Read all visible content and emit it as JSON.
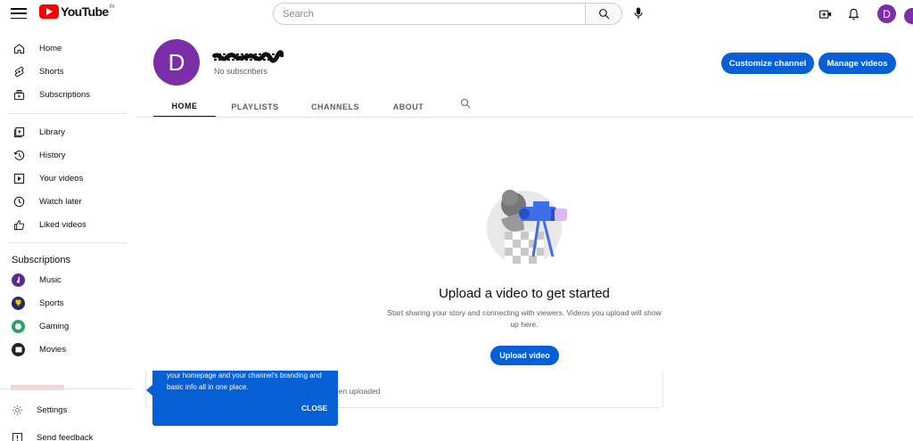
{
  "header": {
    "logo_text": "YouTube",
    "logo_country": "IN",
    "search_placeholder": "Search",
    "avatar_letter": "D"
  },
  "sidebar": {
    "items": [
      {
        "label": "Home",
        "icon": "home-icon"
      },
      {
        "label": "Shorts",
        "icon": "shorts-icon"
      },
      {
        "label": "Subscriptions",
        "icon": "subscriptions-icon"
      },
      {
        "label": "Library",
        "icon": "library-icon"
      },
      {
        "label": "History",
        "icon": "history-icon"
      },
      {
        "label": "Your videos",
        "icon": "your-videos-icon"
      },
      {
        "label": "Watch later",
        "icon": "watch-later-icon"
      },
      {
        "label": "Liked videos",
        "icon": "liked-videos-icon"
      }
    ],
    "subscriptions_heading": "Subscriptions",
    "subscriptions": [
      {
        "label": "Music",
        "color": "#5b2a8c"
      },
      {
        "label": "Sports",
        "color": "#1a2a6e"
      },
      {
        "label": "Gaming",
        "color": "#2aa06a"
      },
      {
        "label": "Movies",
        "color": "#222222"
      }
    ],
    "settings": "Settings",
    "feedback": "Send feedback"
  },
  "channel": {
    "avatar_letter": "D",
    "subscribers": "No subscribers",
    "customize_button": "Customize channel",
    "manage_button": "Manage videos",
    "tabs": [
      "HOME",
      "PLAYLISTS",
      "CHANNELS",
      "ABOUT"
    ],
    "active_tab": "HOME"
  },
  "empty_state": {
    "title": "Upload a video to get started",
    "description": "Start sharing your story and connecting with viewers. Videos you upload will show up here.",
    "upload_button": "Upload video",
    "card_text": "een uploaded"
  },
  "tooltip": {
    "text": "your homepage and your channel's branding and basic info all in one place.",
    "close": "CLOSE"
  },
  "colors": {
    "accent": "#065fd4",
    "avatar": "#7b2ea8",
    "logo_red": "#ff0000"
  }
}
